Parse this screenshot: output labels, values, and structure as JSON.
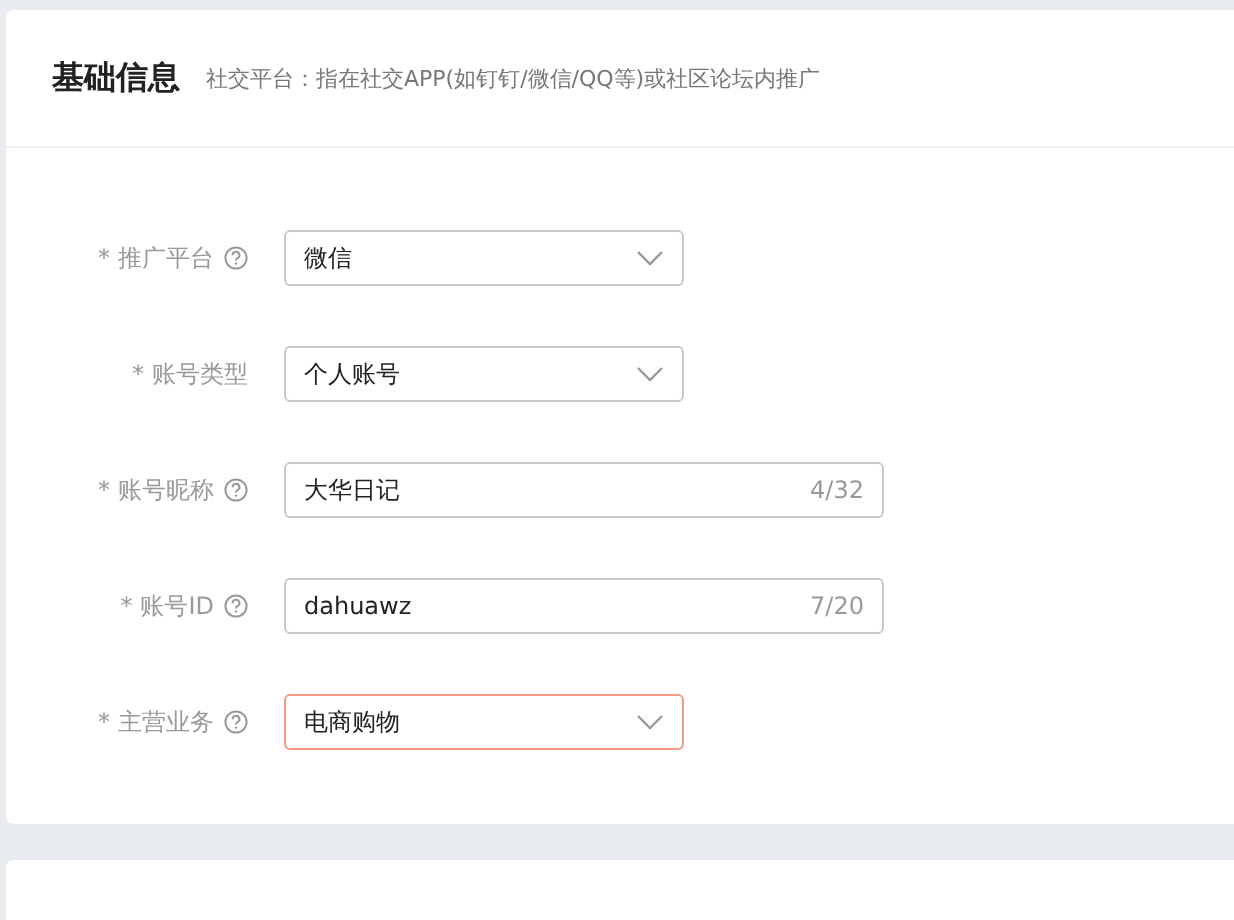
{
  "section": {
    "title": "基础信息",
    "subtitle": "社交平台：指在社交APP(如钉钉/微信/QQ等)或社区论坛内推广"
  },
  "fields": [
    {
      "marker": "*",
      "label": "推广平台",
      "help": true,
      "kind": "select",
      "value": "微信",
      "highlighted": false
    },
    {
      "marker": "*",
      "label": "账号类型",
      "help": false,
      "kind": "select",
      "value": "个人账号",
      "highlighted": false
    },
    {
      "marker": "*",
      "label": "账号昵称",
      "help": true,
      "kind": "input",
      "value": "大华日记",
      "count": "4/32",
      "highlighted": false
    },
    {
      "marker": "*",
      "label": "账号ID",
      "help": true,
      "kind": "input",
      "value": "dahuawz",
      "count": "7/20",
      "highlighted": false
    },
    {
      "marker": "*",
      "label": "主营业务",
      "help": true,
      "kind": "select",
      "value": "电商购物",
      "highlighted": true
    }
  ]
}
